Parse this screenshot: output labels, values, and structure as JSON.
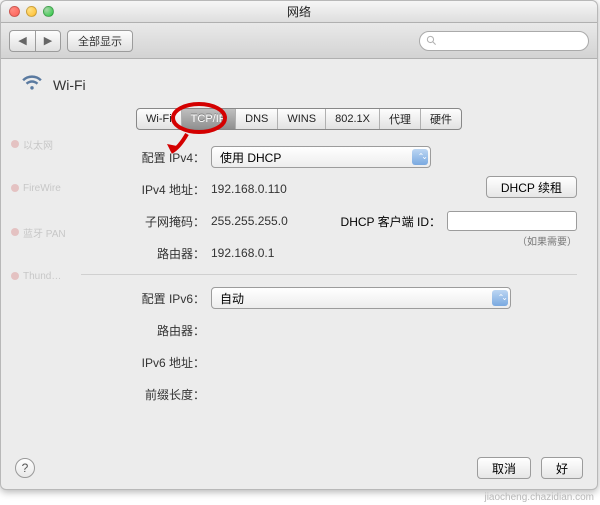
{
  "window": {
    "title": "网络"
  },
  "toolbar": {
    "back_icon": "◀",
    "forward_icon": "▶",
    "show_all": "全部显示"
  },
  "header": {
    "service_name": "Wi-Fi"
  },
  "tabs": [
    {
      "label": "Wi-Fi",
      "active": false
    },
    {
      "label": "TCP/IP",
      "active": true
    },
    {
      "label": "DNS",
      "active": false
    },
    {
      "label": "WINS",
      "active": false
    },
    {
      "label": "802.1X",
      "active": false
    },
    {
      "label": "代理",
      "active": false
    },
    {
      "label": "硬件",
      "active": false
    }
  ],
  "form": {
    "configure_ipv4_label": "配置 IPv4：",
    "configure_ipv4_value": "使用 DHCP",
    "ipv4_addr_label": "IPv4 地址：",
    "ipv4_addr_value": "192.168.0.110",
    "subnet_label": "子网掩码：",
    "subnet_value": "255.255.255.0",
    "router_label": "路由器：",
    "router_value": "192.168.0.1",
    "dhcp_renew_btn": "DHCP 续租",
    "dhcp_client_id_label": "DHCP 客户端 ID：",
    "dhcp_hint": "（如果需要）",
    "configure_ipv6_label": "配置 IPv6：",
    "configure_ipv6_value": "自动",
    "ipv6_router_label": "路由器：",
    "ipv6_addr_label": "IPv6 地址：",
    "prefix_label": "前缀长度："
  },
  "ghost_sidebar": [
    {
      "name": "以太网"
    },
    {
      "name": "FireWire"
    },
    {
      "name": "蓝牙 PAN"
    },
    {
      "name": "Thund…"
    }
  ],
  "footer": {
    "help": "?",
    "cancel": "取消",
    "ok": "好"
  },
  "watermark": "jiaocheng.chazidian.com"
}
